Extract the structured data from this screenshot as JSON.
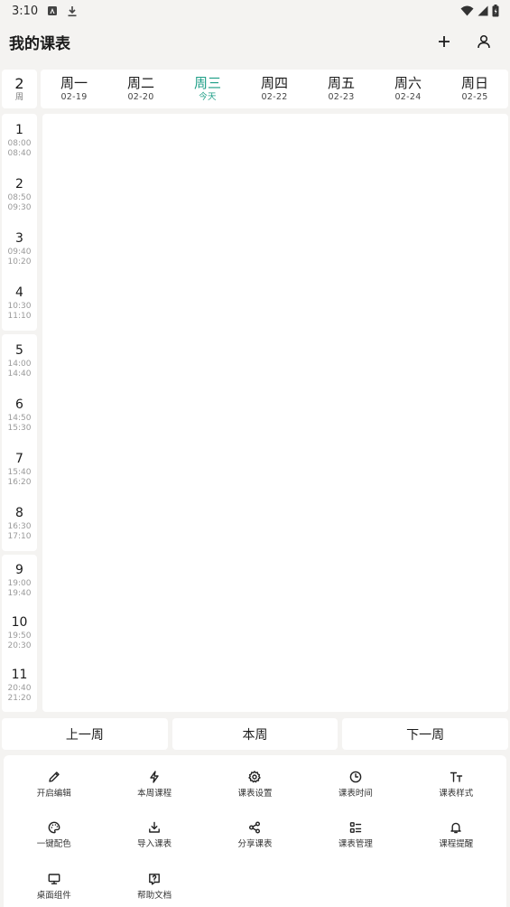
{
  "status_bar": {
    "time": "3:10"
  },
  "app_bar": {
    "title": "我的课表"
  },
  "week": {
    "number": "2",
    "unit": "周"
  },
  "days": [
    {
      "name": "周一",
      "date": "02-19",
      "today": false
    },
    {
      "name": "周二",
      "date": "02-20",
      "today": false
    },
    {
      "name": "周三",
      "date": "今天",
      "today": true
    },
    {
      "name": "周四",
      "date": "02-22",
      "today": false
    },
    {
      "name": "周五",
      "date": "02-23",
      "today": false
    },
    {
      "name": "周六",
      "date": "02-24",
      "today": false
    },
    {
      "name": "周日",
      "date": "02-25",
      "today": false
    }
  ],
  "periods": [
    {
      "num": "1",
      "start": "08:00",
      "end": "08:40"
    },
    {
      "num": "2",
      "start": "08:50",
      "end": "09:30"
    },
    {
      "num": "3",
      "start": "09:40",
      "end": "10:20"
    },
    {
      "num": "4",
      "start": "10:30",
      "end": "11:10"
    },
    {
      "num": "5",
      "start": "14:00",
      "end": "14:40"
    },
    {
      "num": "6",
      "start": "14:50",
      "end": "15:30"
    },
    {
      "num": "7",
      "start": "15:40",
      "end": "16:20"
    },
    {
      "num": "8",
      "start": "16:30",
      "end": "17:10"
    },
    {
      "num": "9",
      "start": "19:00",
      "end": "19:40"
    },
    {
      "num": "10",
      "start": "19:50",
      "end": "20:30"
    },
    {
      "num": "11",
      "start": "20:40",
      "end": "21:20"
    }
  ],
  "nav": {
    "prev": "上一周",
    "current": "本周",
    "next": "下一周"
  },
  "menu": [
    {
      "label": "开启编辑",
      "icon": "pencil-icon"
    },
    {
      "label": "本周课程",
      "icon": "lightning-icon"
    },
    {
      "label": "课表设置",
      "icon": "gear-icon"
    },
    {
      "label": "课表时间",
      "icon": "clock-icon"
    },
    {
      "label": "课表样式",
      "icon": "text-style-icon"
    },
    {
      "label": "一键配色",
      "icon": "palette-icon"
    },
    {
      "label": "导入课表",
      "icon": "import-icon"
    },
    {
      "label": "分享课表",
      "icon": "share-icon"
    },
    {
      "label": "课表管理",
      "icon": "list-manage-icon"
    },
    {
      "label": "课程提醒",
      "icon": "bell-icon"
    },
    {
      "label": "桌面组件",
      "icon": "monitor-icon"
    },
    {
      "label": "帮助文档",
      "icon": "help-doc-icon"
    }
  ],
  "colors": {
    "accent": "#1d9e86",
    "background": "#f4f3f1",
    "card": "#ffffff"
  }
}
